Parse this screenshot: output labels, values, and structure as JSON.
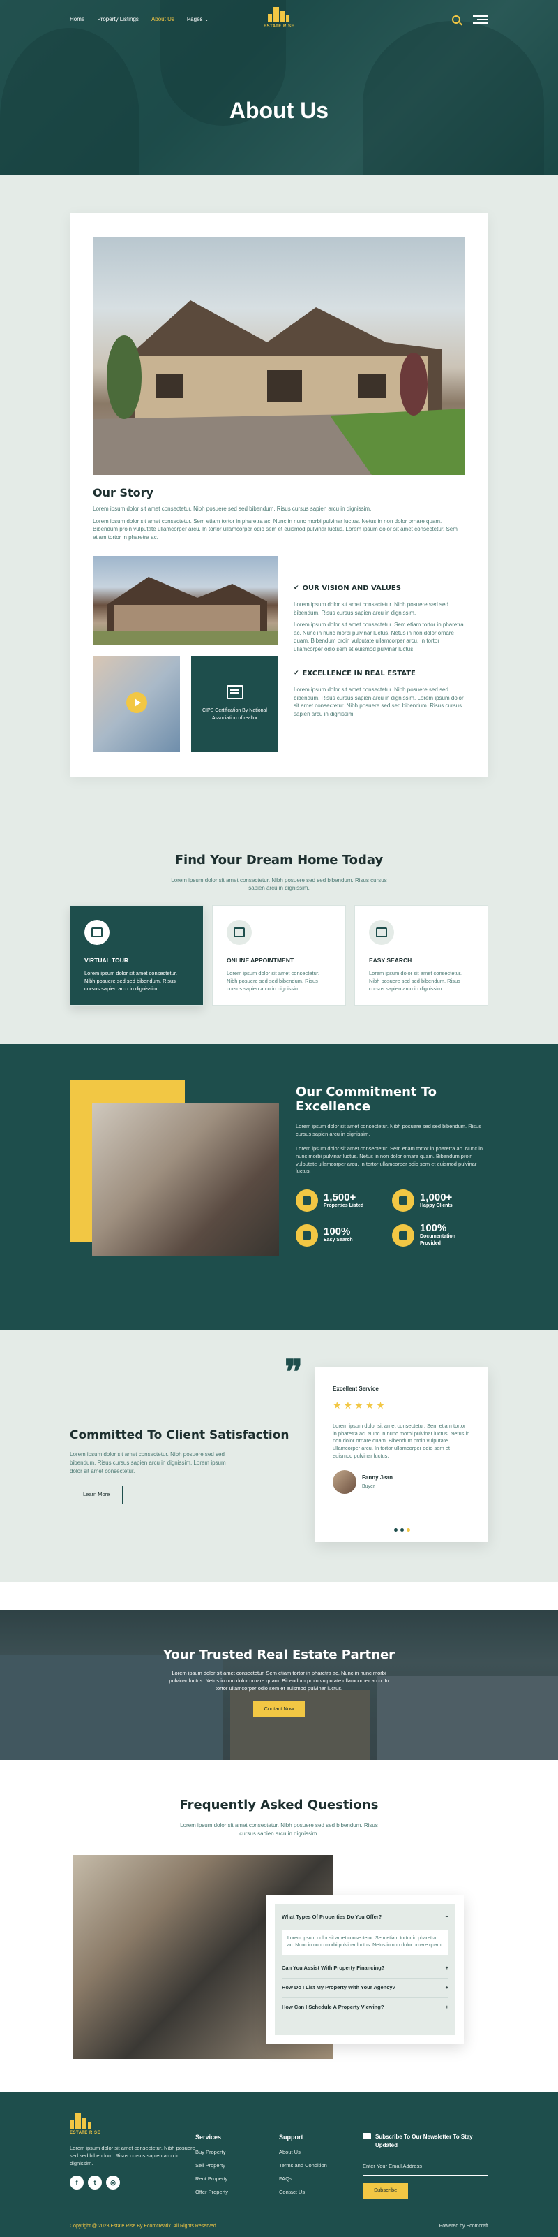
{
  "nav": {
    "links": [
      "Home",
      "Property Listings",
      "About Us",
      "Pages"
    ],
    "active_index": 2,
    "logo_text": "ESTATE RISE"
  },
  "hero": {
    "title": "About Us"
  },
  "story": {
    "title": "Our Story",
    "lead": "Lorem ipsum dolor sit amet consectetur. Nibh posuere sed sed bibendum. Risus cursus sapien arcu in dignissim.",
    "body": "Lorem ipsum dolor sit amet consectetur. Sem etiam tortor in pharetra ac. Nunc in nunc morbi pulvinar luctus. Netus in non dolor ornare quam. Bibendum proin vulputate ullamcorper arcu. In tortor ullamcorper odio sem et euismod pulvinar luctus. Lorem ipsum dolor sit amet consectetur. Sem etiam tortor in pharetra ac.",
    "cert_text": "CIPS Certification By National Association of realtor",
    "vision_title": "OUR VISION AND VALUES",
    "vision_p1": "Lorem ipsum dolor sit amet consectetur. Nibh posuere sed sed bibendum. Risus cursus sapien arcu in dignissim.",
    "vision_p2": "Lorem ipsum dolor sit amet consectetur. Sem etiam tortor in pharetra ac. Nunc in nunc morbi pulvinar luctus. Netus in non dolor ornare quam. Bibendum proin vulputate ullamcorper arcu. In tortor ullamcorper odio sem et euismod pulvinar luctus.",
    "excellence_title": "EXCELLENCE IN REAL ESTATE",
    "excellence_p": "Lorem ipsum dolor sit amet consectetur. Nibh posuere sed sed bibendum. Risus cursus sapien arcu in dignissim. Lorem ipsum dolor sit amet consectetur. Nibh posuere sed sed bibendum. Risus cursus sapien arcu in dignissim."
  },
  "dream": {
    "title": "Find Your Dream Home Today",
    "subtitle": "Lorem ipsum dolor sit amet consectetur. Nibh posuere sed sed bibendum. Risus cursus sapien arcu in dignissim.",
    "cards": [
      {
        "title": "VIRTUAL TOUR",
        "text": "Lorem ipsum dolor sit amet consectetur. Nibh posuere sed sed bibendum. Risus cursus sapien arcu in dignissim."
      },
      {
        "title": "ONLINE APPOINTMENT",
        "text": "Lorem ipsum dolor sit amet consectetur. Nibh posuere sed sed bibendum. Risus cursus sapien arcu in dignissim."
      },
      {
        "title": "EASY SEARCH",
        "text": "Lorem ipsum dolor sit amet consectetur. Nibh posuere sed sed bibendum. Risus cursus sapien arcu in dignissim."
      }
    ]
  },
  "commitment": {
    "title": "Our Commitment To Excellence",
    "p1": "Lorem ipsum dolor sit amet consectetur. Nibh posuere sed sed bibendum. Risus cursus sapien arcu in dignissim.",
    "p2": "Lorem ipsum dolor sit amet consectetur. Sem etiam tortor in pharetra ac. Nunc in nunc morbi pulvinar luctus. Netus in non dolor ornare quam. Bibendum proin vulputate ullamcorper arcu. In tortor ullamcorper odio sem et euismod pulvinar luctus.",
    "stats": [
      {
        "value": "1,500+",
        "label": "Properties Listed"
      },
      {
        "value": "1,000+",
        "label": "Happy Clients"
      },
      {
        "value": "100%",
        "label": "Easy Search"
      },
      {
        "value": "100%",
        "label": "Documentation Provided"
      }
    ]
  },
  "testimonial": {
    "title": "Committed To Client Satisfaction",
    "subtitle": "Lorem ipsum dolor sit amet consectetur. Nibh posuere sed sed bibendum. Risus cursus sapien arcu in dignissim. Lorem ipsum dolor sit amet consectetur.",
    "button": "Learn More",
    "card_title": "Excellent Service",
    "rating": 5,
    "text": "Lorem ipsum dolor sit amet consectetur. Sem etiam tortor in pharetra ac. Nunc in nunc morbi pulvinar luctus. Netus in non dolor ornare quam. Bibendum proin vulputate ullamcorper arcu. In tortor ullamcorper odio sem et euismod pulvinar luctus.",
    "author": "Fanny Jean",
    "role": "Buyer"
  },
  "partner": {
    "title": "Your Trusted Real Estate Partner",
    "text": "Lorem ipsum dolor sit amet consectetur. Sem etiam tortor in pharetra ac. Nunc in nunc morbi pulvinar luctus. Netus in non dolor ornare quam. Bibendum proin vulputate ullamcorper arcu. In tortor ullamcorper odio sem et euismod pulvinar luctus.",
    "button": "Contact Now"
  },
  "faq": {
    "title": "Frequently Asked Questions",
    "subtitle": "Lorem ipsum dolor sit amet consectetur. Nibh posuere sed sed bibendum. Risus cursus sapien arcu in dignissim.",
    "q1": "What Types Of Properties Do You Offer?",
    "a1": "Lorem ipsum dolor sit amet consectetur. Sem etiam tortor in pharetra ac. Nunc in nunc morbi pulvinar luctus. Netus in non dolor ornare quam.",
    "q2": "Can You Assist With Property Financing?",
    "q3": "How Do I List My Property With Your Agency?",
    "q4": "How Can I Schedule A Property Viewing?"
  },
  "footer": {
    "logo_text": "ESTATE RISE",
    "about": "Lorem ipsum dolor sit amet consectetur. Nibh posuere sed sed bibendum. Risus cursus sapien arcu in dignissim.",
    "services_title": "Services",
    "services": [
      "Buy Property",
      "Sell Property",
      "Rent Property",
      "Offer Property"
    ],
    "support_title": "Support",
    "support": [
      "About Us",
      "Terms and Condition",
      "FAQs",
      "Contact Us"
    ],
    "newsletter_title": "Subscribe To Our Newsletter To Stay Updated",
    "email_placeholder": "Enter Your Email Address",
    "subscribe": "Subscribe",
    "copyright": "Copyright @ 2023 Estate Rise By Ecomcreatix. All Rights Reserved",
    "powered": "Powered by Ecomcraft"
  },
  "colors": {
    "primary": "#1e4e4c",
    "accent": "#f2c744",
    "light_bg": "#e4ebe7"
  }
}
